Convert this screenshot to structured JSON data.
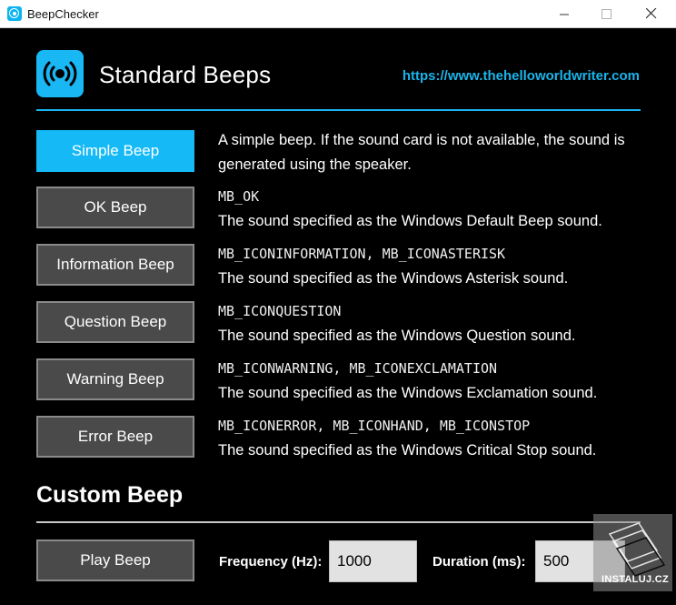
{
  "window": {
    "title": "BeepChecker",
    "minimize": "minimize",
    "maximize": "maximize",
    "close": "close"
  },
  "header": {
    "title": "Standard Beeps",
    "link": "https://www.thehelloworldwriter.com",
    "icon": "speaker-waves-icon"
  },
  "beeps": [
    {
      "label": "Simple Beep",
      "code": "",
      "desc": "A simple beep. If the sound card is not available, the sound is generated using the speaker."
    },
    {
      "label": "OK Beep",
      "code": "MB_OK",
      "desc": "The sound specified as the Windows Default Beep sound."
    },
    {
      "label": "Information Beep",
      "code": "MB_ICONINFORMATION, MB_ICONASTERISK",
      "desc": "The sound specified as the Windows Asterisk sound."
    },
    {
      "label": "Question Beep",
      "code": "MB_ICONQUESTION",
      "desc": "The sound specified as the Windows Question sound."
    },
    {
      "label": "Warning Beep",
      "code": "MB_ICONWARNING, MB_ICONEXCLAMATION",
      "desc": "The sound specified as the Windows Exclamation sound."
    },
    {
      "label": "Error Beep",
      "code": "MB_ICONERROR, MB_ICONHAND, MB_ICONSTOP",
      "desc": "The sound specified as the Windows Critical Stop sound."
    }
  ],
  "custom": {
    "title": "Custom Beep",
    "play_label": "Play Beep",
    "frequency_label": "Frequency (Hz):",
    "frequency_value": "1000",
    "duration_label": "Duration (ms):",
    "duration_value": "500"
  },
  "watermark": {
    "text": "INSTALUJ.CZ"
  },
  "colors": {
    "accent": "#19b7f3",
    "background": "#000000",
    "button": "#4a4a4a"
  }
}
